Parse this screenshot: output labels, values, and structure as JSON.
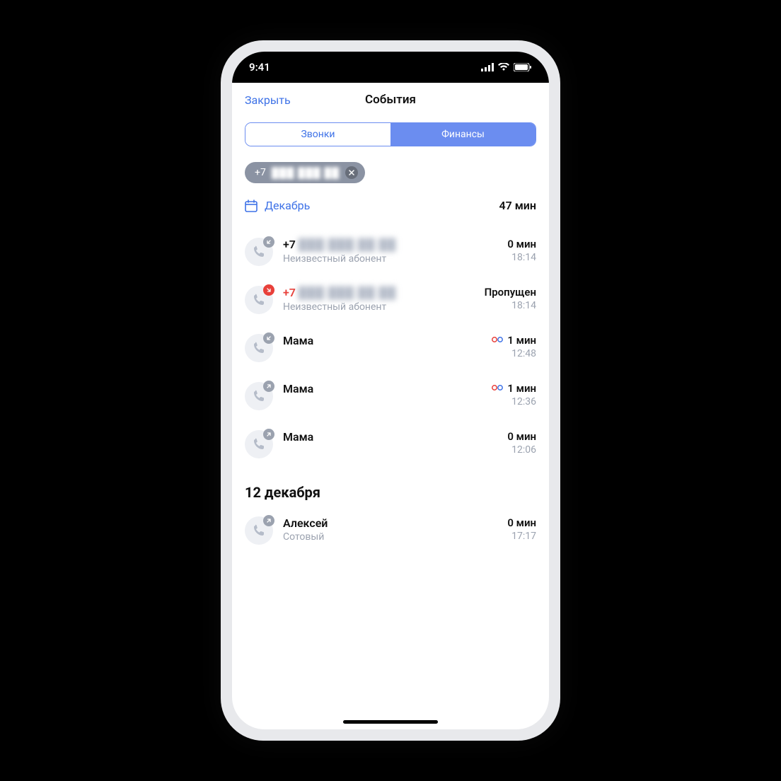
{
  "status_bar": {
    "time": "9:41"
  },
  "header": {
    "close": "Закрыть",
    "title": "События"
  },
  "tabs": {
    "calls": "Звонки",
    "finance": "Финансы"
  },
  "filter_chip": {
    "prefix": "+7",
    "masked": "███ ███ ██"
  },
  "month": {
    "label": "Декабрь",
    "total": "47 мин"
  },
  "calls": [
    {
      "name": "+7",
      "masked": true,
      "sub": "Неизвестный абонент",
      "duration": "0 мин",
      "time": "18:14",
      "type": "incoming",
      "missed": false,
      "vm": false
    },
    {
      "name": "+7",
      "masked": true,
      "sub": "Неизвестный абонент",
      "duration": "Пропущен",
      "time": "18:14",
      "type": "missed",
      "missed": true,
      "vm": false
    },
    {
      "name": "Мама",
      "masked": false,
      "sub": "",
      "duration": "1 мин",
      "time": "12:48",
      "type": "incoming",
      "missed": false,
      "vm": true
    },
    {
      "name": "Мама",
      "masked": false,
      "sub": "",
      "duration": "1 мин",
      "time": "12:36",
      "type": "outgoing",
      "missed": false,
      "vm": true
    },
    {
      "name": "Мама",
      "masked": false,
      "sub": "",
      "duration": "0 мин",
      "time": "12:06",
      "type": "outgoing",
      "missed": false,
      "vm": false
    }
  ],
  "section2": {
    "header": "12 декабря"
  },
  "calls2": [
    {
      "name": "Алексей",
      "masked": false,
      "sub": "Сотовый",
      "duration": "0 мин",
      "time": "17:17",
      "type": "outgoing",
      "missed": false,
      "vm": false
    }
  ]
}
